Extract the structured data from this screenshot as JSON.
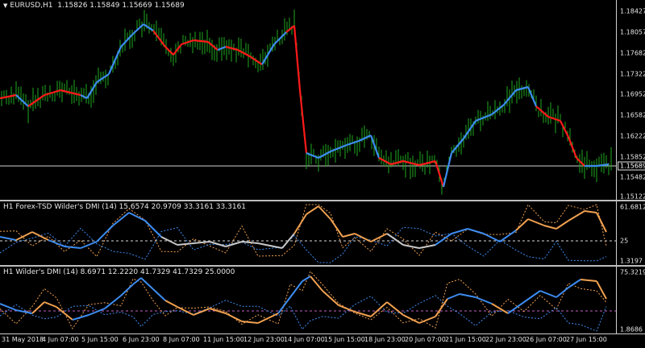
{
  "main_pane": {
    "title": "EURUSD,H1  1.15826 1.15849 1.15669 1.15689",
    "price_scale": [
      "1.18427",
      "1.18057",
      "1.17682",
      "1.17322",
      "1.16952",
      "1.16582",
      "1.16222",
      "1.15852",
      "1.15482",
      "1.15122"
    ],
    "current_price": "1.15689"
  },
  "ind1_pane": {
    "title": "H1 Forex-TSD Wilder's DMI (14) 15.6574 20.9709 33.3161 33.3161",
    "scale": [
      "61.6812",
      "25",
      "1.3197"
    ]
  },
  "ind2_pane": {
    "title": "H1 Wilder's DMI (14) 8.6971 12.2220 41.7329 41.7329 25.0000",
    "scale": [
      "75.3219",
      "1.8686"
    ]
  },
  "time_axis": [
    "31 May 2018",
    "4 Jun 07:00",
    "5 Jun 15:00",
    "6 Jun 23:00",
    "8 Jun 07:00",
    "11 Jun 15:00",
    "12 Jun 23:00",
    "14 Jun 07:00",
    "15 Jun 15:00",
    "18 Jun 23:00",
    "20 Jun 07:00",
    "21 Jun 15:00",
    "22 Jun 23:00",
    "26 Jun 07:00",
    "27 Jun 15:00"
  ],
  "colors": {
    "up_bar": "#1fa81f",
    "trend_up": "#3d8cf0",
    "trend_down": "#ff1a1a",
    "orange": "#f0a050",
    "gray": "#c8c8c8"
  }
}
